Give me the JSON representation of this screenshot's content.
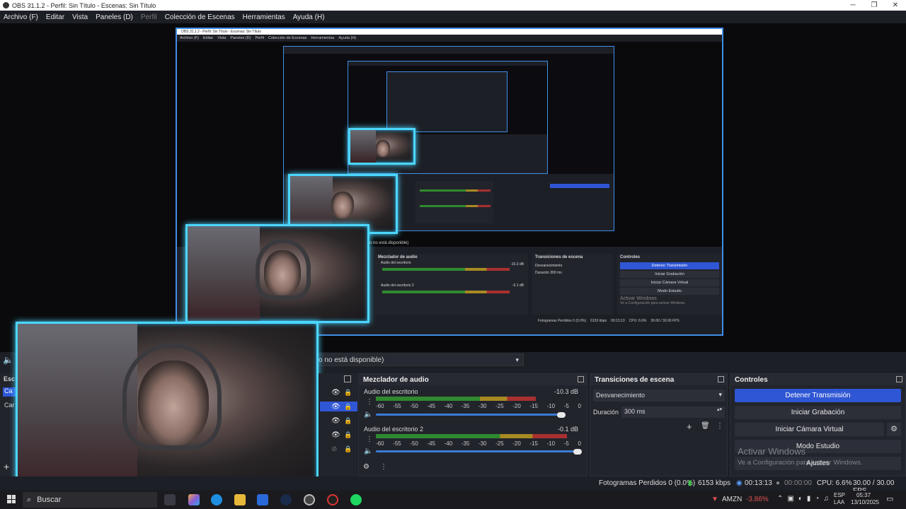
{
  "window": {
    "title": "OBS 31.1.2 - Perfil: Sin Título - Escenas: Sin Título",
    "minimize": "─",
    "restore": "❐",
    "close": "✕"
  },
  "menu": {
    "items": [
      "Archivo (F)",
      "Editar",
      "Vista",
      "Paneles (D)",
      "Perfil",
      "Colección de Escenas",
      "Herramientas",
      "Ayuda (H)"
    ]
  },
  "preview_inner": {
    "title": "OBS 31.1.2 - Perfil: Sin Título - Escenas: Sin Título",
    "menu": [
      "Archivo (F)",
      "Editar",
      "Vista",
      "Paneles (D)",
      "Perfil",
      "Colección de Escenas",
      "Herramientas",
      "Ayuda (H)"
    ],
    "source_unavailable": "o no está disponible)",
    "mixer_title": "Mezclador de audio",
    "desktop_audio": "Audio del escritorio",
    "desktop_audio_db": "-10.3 dB",
    "desktop_audio2": "Audio del escritorio 2",
    "desktop_audio2_db": "-0.1 dB",
    "transitions_title": "Transiciones de escena",
    "transition_value": "Desvanecimiento",
    "duration_label": "Duración",
    "duration_value": "300 ms",
    "controls_title": "Controles",
    "stop_stream": "Detener Transmisión",
    "start_record": "Iniciar Grabación",
    "start_vcam": "Iniciar Cámara Virtual",
    "studio_mode": "Modo Estudio",
    "activate_windows": "Activar Windows",
    "activate_windows_sub": "Ve a Configuración para activar Windows.",
    "status": "Fotogramas Perdidos 0 (0.0%)",
    "kbps": "6153 kbps",
    "time": "00:13:13",
    "cpu": "CPU: 6.6%",
    "fps": "30.00 / 30.00 FPS"
  },
  "source_bar": {
    "label": "o no está disponible)"
  },
  "mixer": {
    "title": "Mezclador de audio",
    "channels": [
      {
        "name": "Audio del escritorio",
        "db": "-10.3 dB",
        "level": 0.78,
        "volume": 0.91
      },
      {
        "name": "Audio del escritorio 2",
        "db": "-0.1 dB",
        "level": 0.93,
        "volume": 0.99
      }
    ],
    "ticks": [
      "-60",
      "-55",
      "-50",
      "-45",
      "-40",
      "-35",
      "-30",
      "-25",
      "-20",
      "-15",
      "-10",
      "-5",
      "0"
    ]
  },
  "transitions": {
    "title": "Transiciones de escena",
    "selected": "Desvanecimiento",
    "duration_label": "Duración",
    "duration_value": "300 ms"
  },
  "controls": {
    "title": "Controles",
    "stop_stream": "Detener Transmisión",
    "start_record": "Iniciar Grabación",
    "start_vcam": "Iniciar Cámara Virtual",
    "studio_mode": "Modo Estudio",
    "settings": "Ajustes"
  },
  "activation": {
    "title": "Activar Windows",
    "subtitle": "Ve a Configuración para activar Windows."
  },
  "scenes_dock": {
    "title": "Esc",
    "item1": "Ca",
    "item2": "Car"
  },
  "status": {
    "dropped": "Fotogramas Perdidos 0 (0.0%)",
    "kbps": "6153 kbps",
    "stream_time": "00:13:13",
    "record_time": "00:00:00",
    "cpu": "CPU: 6.6%",
    "fps": "30.00 / 30.00 FPS"
  },
  "taskbar": {
    "search": "Buscar",
    "stock": "AMZN",
    "stock_change": "-3.86%",
    "lang1": "ESP",
    "lang2": "LAA",
    "time": "05:37",
    "date": "13/10/2025"
  },
  "colors": {
    "accent": "#2f56d4",
    "glow": "#4cd6ff",
    "stock_down": "#e05050"
  }
}
